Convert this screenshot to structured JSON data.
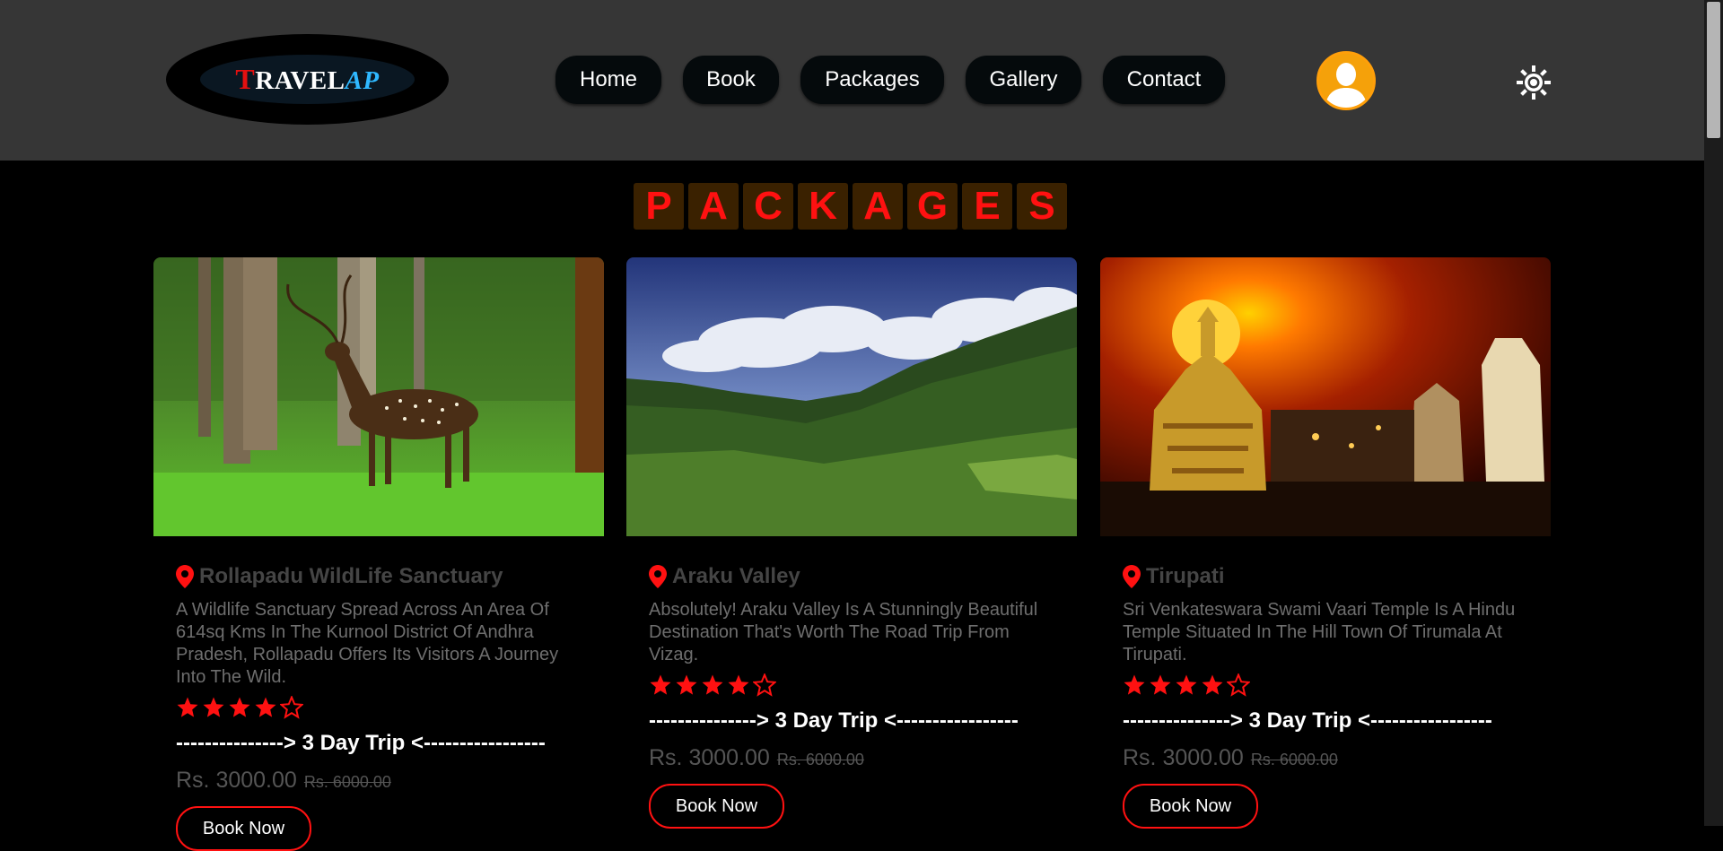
{
  "logo": {
    "first_letter": "T",
    "rest": "RAVEL",
    "suffix": "AP"
  },
  "nav": [
    {
      "label": "Home"
    },
    {
      "label": "Book"
    },
    {
      "label": "Packages"
    },
    {
      "label": "Gallery"
    },
    {
      "label": "Contact"
    }
  ],
  "icons": {
    "avatar": "user-avatar-icon",
    "theme": "sun-theme-toggle-icon",
    "location": "map-pin-icon",
    "star": "star-icon"
  },
  "colors": {
    "accent": "#ff1111",
    "avatar": "#ff9f0a",
    "header_bg": "#363636",
    "title_tile": "#3a2100"
  },
  "page_title": [
    "P",
    "A",
    "C",
    "K",
    "A",
    "G",
    "E",
    "S"
  ],
  "packages": [
    {
      "title": "Rollapadu WildLife Sanctuary",
      "description": "A Wildlife Sanctuary Spread Across An Area Of 614sq Kms In The Kurnool District Of Andhra Pradesh, Rollapadu Offers Its Visitors A Journey Into The Wild.",
      "rating": 4,
      "rating_max": 5,
      "trip": "---------------> 3 Day Trip <-----------------",
      "price": "Rs. 3000.00",
      "old_price": "Rs. 6000.00",
      "button": "Book Now"
    },
    {
      "title": "Araku Valley",
      "description": "Absolutely! Araku Valley Is A Stunningly Beautiful Destination That's Worth The Road Trip From Vizag.",
      "rating": 4,
      "rating_max": 5,
      "trip": "---------------> 3 Day Trip <-----------------",
      "price": "Rs. 3000.00",
      "old_price": "Rs. 6000.00",
      "button": "Book Now"
    },
    {
      "title": "Tirupati",
      "description": "Sri Venkateswara Swami Vaari Temple Is A Hindu Temple Situated In The Hill Town Of Tirumala At Tirupati.",
      "rating": 4,
      "rating_max": 5,
      "trip": "---------------> 3 Day Trip <-----------------",
      "price": "Rs. 3000.00",
      "old_price": "Rs. 6000.00",
      "button": "Book Now"
    }
  ]
}
